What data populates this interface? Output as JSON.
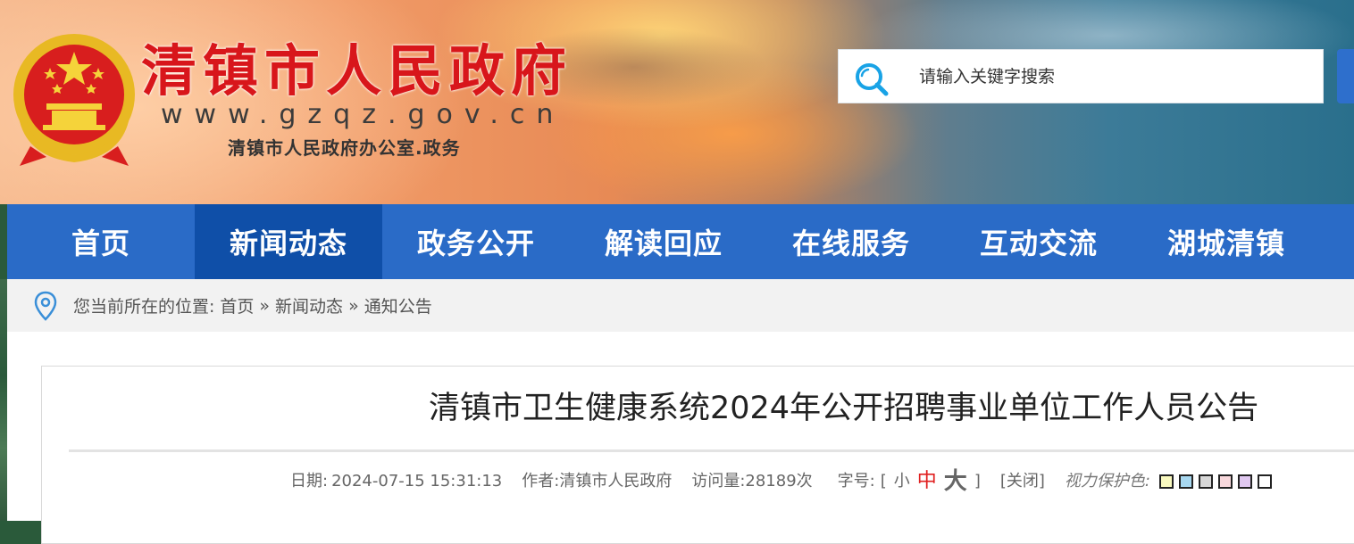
{
  "header": {
    "site_name": "清镇市人民政府",
    "site_url": "www.gzqz.gov.cn",
    "site_subtitle": "清镇市人民政府办公室.政务"
  },
  "search": {
    "placeholder": "请输入关键字搜索"
  },
  "nav": {
    "items": [
      {
        "label": "首页"
      },
      {
        "label": "新闻动态"
      },
      {
        "label": "政务公开"
      },
      {
        "label": "解读回应"
      },
      {
        "label": "在线服务"
      },
      {
        "label": "互动交流"
      },
      {
        "label": "湖城清镇"
      }
    ],
    "active_index": 1
  },
  "breadcrumb": {
    "prefix": "您当前所在的位置:",
    "items": [
      "首页",
      "新闻动态",
      "通知公告"
    ],
    "separator": "»"
  },
  "article": {
    "title": "清镇市卫生健康系统2024年公开招聘事业单位工作人员公告",
    "date_label": "日期:",
    "date": "2024-07-15 15:31:13",
    "author_label": "作者:",
    "author": "清镇市人民政府",
    "views_label": "访问量:",
    "views": "28189次",
    "fontsize_label": "字号:",
    "fontsize_open": "[",
    "fontsize_small": "小",
    "fontsize_medium": "中",
    "fontsize_large": "大",
    "fontsize_close": "]",
    "close_label": "[关闭]",
    "eye_label": "视力保护色:",
    "eye_colors": [
      "#fafac0",
      "#a8d8f0",
      "#d8d8d8",
      "#f8d8dc",
      "#e0c8f0",
      "#ffffff"
    ]
  },
  "colors": {
    "nav_bg": "#2a6bc7",
    "nav_active": "#0f4fa8",
    "title_red": "#d8161b"
  }
}
